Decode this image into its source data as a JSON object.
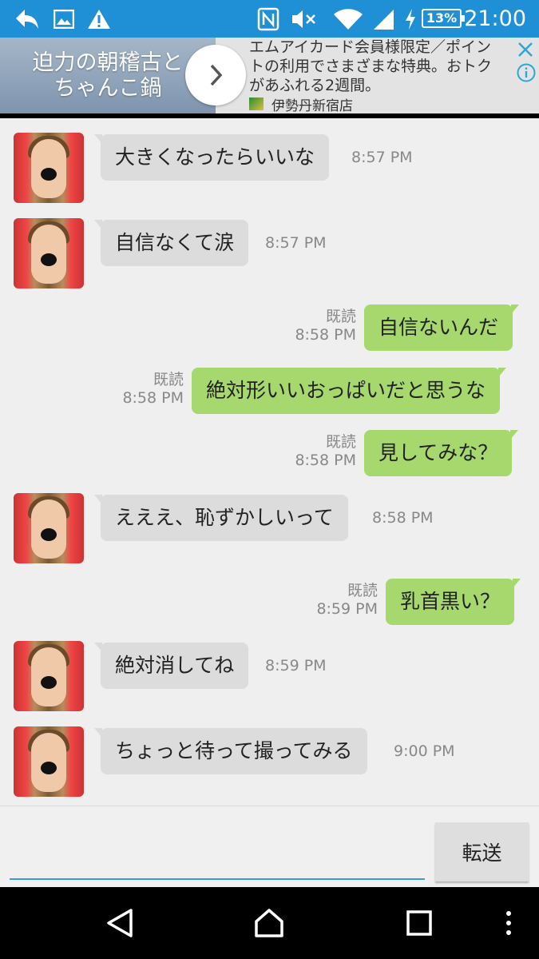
{
  "status_bar": {
    "battery": "13%",
    "time": "21:00",
    "icons": [
      "reply-icon",
      "image-icon",
      "warning-icon",
      "nfc-icon",
      "mute-icon",
      "wifi-icon",
      "signal-icon",
      "charging-icon",
      "battery-icon"
    ]
  },
  "ad": {
    "image_line1": "迫力の朝稽古と",
    "image_line2": "ちゃんこ鍋",
    "text_line1": "エムアイカード会員様限定／ポイン",
    "text_line2": "トの利用でさまざまな特典。おトク",
    "text_line3": "があふれる2週間。",
    "source": "伊勢丹新宿店",
    "icons": [
      "chevron-right-icon",
      "close-icon",
      "info-icon"
    ]
  },
  "messages": [
    {
      "direction": "in",
      "text": "大きくなったらいいな",
      "time": "8:57 PM"
    },
    {
      "direction": "in",
      "text": "自信なくて涙",
      "time": "8:57 PM"
    },
    {
      "direction": "out",
      "text": "自信ないんだ",
      "read": "既読",
      "time": "8:58 PM"
    },
    {
      "direction": "out",
      "text": "絶対形いいおっぱいだと思うな",
      "read": "既読",
      "time": "8:58 PM"
    },
    {
      "direction": "out",
      "text": "見してみな？",
      "read": "既読",
      "time": "8:58 PM"
    },
    {
      "direction": "in",
      "text": "えええ、恥ずかしいって",
      "time": "8:58 PM"
    },
    {
      "direction": "out",
      "text": "乳首黒い？",
      "read": "既読",
      "time": "8:59 PM"
    },
    {
      "direction": "in",
      "text": "絶対消してね",
      "time": "8:59 PM"
    },
    {
      "direction": "in",
      "text": "ちょっと待って撮ってみる",
      "time": "9:00 PM"
    }
  ],
  "composer": {
    "input_value": "",
    "send_label": "転送",
    "accent_color": "#35a0d8"
  },
  "navbar": {
    "icons": [
      "back-icon",
      "home-icon",
      "recents-icon",
      "more-icon"
    ]
  },
  "colors": {
    "status_bar": "#1f8fd6",
    "incoming_bubble": "#dcdcdc",
    "outgoing_bubble": "#a6d86e"
  }
}
